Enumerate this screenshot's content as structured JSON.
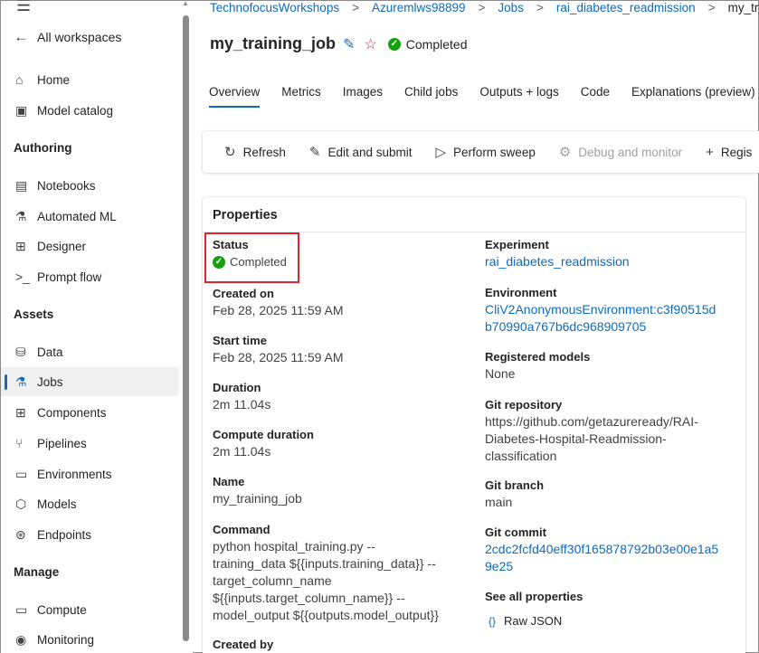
{
  "sidebar": {
    "all_workspaces": "All workspaces",
    "items_top": [
      {
        "label": "Home",
        "icon": "home-icon",
        "glyph": "⌂"
      },
      {
        "label": "Model catalog",
        "icon": "model-catalog-icon",
        "glyph": "▣"
      }
    ],
    "sections": {
      "authoring": "Authoring",
      "assets": "Assets",
      "manage": "Manage"
    },
    "authoring_items": [
      {
        "label": "Notebooks",
        "icon": "notebook-icon",
        "glyph": "▤"
      },
      {
        "label": "Automated ML",
        "icon": "automl-icon",
        "glyph": "⚗"
      },
      {
        "label": "Designer",
        "icon": "designer-icon",
        "glyph": "⊞"
      },
      {
        "label": "Prompt flow",
        "icon": "prompt-flow-icon",
        "glyph": ">_"
      }
    ],
    "assets_items": [
      {
        "label": "Data",
        "icon": "data-icon",
        "glyph": "⛁"
      },
      {
        "label": "Jobs",
        "icon": "jobs-icon",
        "glyph": "⚗"
      },
      {
        "label": "Components",
        "icon": "components-icon",
        "glyph": "⊞"
      },
      {
        "label": "Pipelines",
        "icon": "pipelines-icon",
        "glyph": "⑂"
      },
      {
        "label": "Environments",
        "icon": "environments-icon",
        "glyph": "▭"
      },
      {
        "label": "Models",
        "icon": "models-icon",
        "glyph": "⬡"
      },
      {
        "label": "Endpoints",
        "icon": "endpoints-icon",
        "glyph": "⊛"
      }
    ],
    "manage_items": [
      {
        "label": "Compute",
        "icon": "compute-icon",
        "glyph": "▭"
      },
      {
        "label": "Monitoring",
        "icon": "monitoring-icon",
        "glyph": "◉"
      }
    ]
  },
  "breadcrumb": [
    "TechnofocusWorkshops",
    "Azuremlws98899",
    "Jobs",
    "rai_diabetes_readmission",
    "my_training_job"
  ],
  "header": {
    "title": "my_training_job",
    "status": "Completed"
  },
  "tabs": [
    "Overview",
    "Metrics",
    "Images",
    "Child jobs",
    "Outputs + logs",
    "Code",
    "Explanations (preview)"
  ],
  "toolbar": {
    "refresh": "Refresh",
    "edit_submit": "Edit and submit",
    "perform_sweep": "Perform sweep",
    "debug_monitor": "Debug and monitor",
    "register": "Regis"
  },
  "properties": {
    "title": "Properties",
    "status_label": "Status",
    "status_value": "Completed",
    "created_on_label": "Created on",
    "created_on_value": "Feb 28, 2025 11:59 AM",
    "start_time_label": "Start time",
    "start_time_value": "Feb 28, 2025 11:59 AM",
    "duration_label": "Duration",
    "duration_value": "2m 11.04s",
    "compute_duration_label": "Compute duration",
    "compute_duration_value": "2m 11.04s",
    "name_label": "Name",
    "name_value": "my_training_job",
    "command_label": "Command",
    "command_lines": [
      "python hospital_training.py --",
      "training_data ${{inputs.training_data}} --",
      "target_column_name",
      "${{inputs.target_column_name}} --",
      "model_output ${{outputs.model_output}}"
    ],
    "created_by_label": "Created by",
    "experiment_label": "Experiment",
    "experiment_value": "rai_diabetes_readmission",
    "environment_label": "Environment",
    "environment_lines": [
      "CliV2AnonymousEnvironment:c3f90515d",
      "b70990a767b6dc968909705"
    ],
    "registered_models_label": "Registered models",
    "registered_models_value": "None",
    "git_repo_label": "Git repository",
    "git_repo_lines": [
      "https://github.com/getazureready/RAI-",
      "Diabetes-Hospital-Readmission-",
      "classification"
    ],
    "git_branch_label": "Git branch",
    "git_branch_value": "main",
    "git_commit_label": "Git commit",
    "git_commit_lines": [
      "2cdc2fcfd40eff30f165878792b03e00e1a5",
      "9e25"
    ],
    "see_all_label": "See all properties",
    "raw_json": "Raw JSON"
  },
  "colors": {
    "accent": "#0f6cbd",
    "success": "#13a10e",
    "highlight_box": "#e0262c"
  }
}
